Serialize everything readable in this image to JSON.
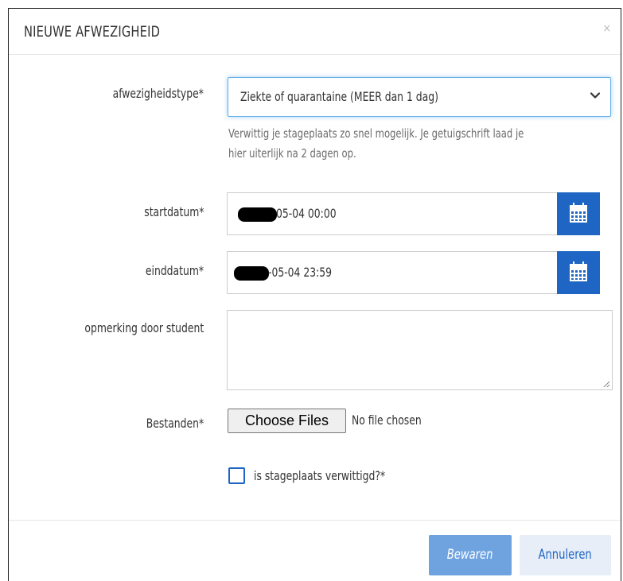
{
  "dialog": {
    "title": "NIEUWE AFWEZIGHEID",
    "close_symbol": "×"
  },
  "form": {
    "absence_type": {
      "label": "afwezigheidstype*",
      "selected": "Ziekte of quarantaine (MEER dan 1 dag)",
      "help_line1": "Verwittig je stageplaats zo snel mogelijk. Je getuigschrift laad je",
      "help_line2": "hier uiterlijk na 2 dagen op."
    },
    "start_date": {
      "label": "startdatum*",
      "value_visible": "05-04 00:00"
    },
    "end_date": {
      "label": "einddatum*",
      "value_visible": "-05-04 23:59"
    },
    "remark": {
      "label": "opmerking door student",
      "value": ""
    },
    "files": {
      "label": "Bestanden*",
      "button_label": "Choose Files",
      "status": "No file chosen"
    },
    "notified": {
      "label": "is stageplaats verwittigd?*",
      "checked": false
    }
  },
  "footer": {
    "save_label": "Bewaren",
    "cancel_label": "Annuleren"
  },
  "colors": {
    "primary": "#1f66c4",
    "save_button": "#6fa3e0",
    "cancel_button_bg": "#e8eef8"
  },
  "icons": {
    "select_arrow": "chevron-down-icon",
    "date_picker": "calendar-icon",
    "close": "close-icon"
  }
}
